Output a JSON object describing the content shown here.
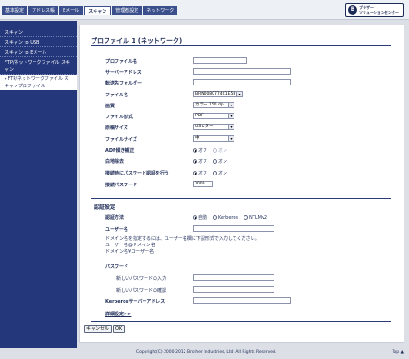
{
  "nav": {
    "tabs": [
      {
        "label": "基本設定",
        "active": false
      },
      {
        "label": "アドレス帳",
        "active": false
      },
      {
        "label": "Eメール",
        "active": false
      },
      {
        "label": "スキャン",
        "active": true
      },
      {
        "label": "管理者設定",
        "active": false
      },
      {
        "label": "ネットワーク",
        "active": false
      }
    ],
    "logo_mark": "B",
    "logo_line1": "ブラザー",
    "logo_line2": "ソリューションセンター"
  },
  "sidebar": {
    "items": [
      {
        "label": "スキャン",
        "active": false
      },
      {
        "label": "スキャン to USB",
        "active": false
      },
      {
        "label": "スキャン to Eメール",
        "active": false
      },
      {
        "label": "FTP/ネットワークファイル スキャン",
        "active": false
      },
      {
        "label": "FTP/ネットワークファイル スキャンプロファイル",
        "active": true,
        "marker": "▸"
      }
    ]
  },
  "main": {
    "title": "プロファイル 1 (ネットワーク)",
    "fields": {
      "profile_name": {
        "label": "プロファイル名",
        "value": ""
      },
      "server_address": {
        "label": "サーバーアドレス",
        "value": ""
      },
      "dest_folder": {
        "label": "転送先フォルダー",
        "value": ""
      },
      "file_name": {
        "label": "ファイル名",
        "value": "BRN0080774C1E58"
      },
      "quality": {
        "label": "画質",
        "value": "カラー 150 dpi"
      },
      "file_type": {
        "label": "ファイル形式",
        "value": "PDF"
      },
      "doc_size": {
        "label": "原稿サイズ",
        "value": "USレター"
      },
      "file_size": {
        "label": "ファイルサイズ",
        "value": "中"
      },
      "adf_deskew": {
        "label": "ADF傾き補正",
        "on": "オフ",
        "off": "オン"
      },
      "remove_bg": {
        "label": "白地除去",
        "on": "オフ",
        "off": "オン"
      },
      "pw_confirm": {
        "label": "接続時にパスワード認証を行う",
        "on": "オフ",
        "off": "オン"
      },
      "pin": {
        "label": "接続パスワード",
        "value": "0000"
      }
    },
    "auth": {
      "section_title": "認証設定",
      "method_label": "認証方法",
      "methods": [
        "自動",
        "Kerberos",
        "NTLMv2"
      ],
      "username_label": "ユーザー名",
      "username_value": "",
      "note_line1": "ドメイン名を指定するには、ユーザー名欄に下記形式で入力してください。",
      "note_line2": "ユーザー名@ドメイン名",
      "note_line3": "ドメイン名¥ユーザー名",
      "password_label": "パスワード",
      "new_password_label": "新しいパスワードの入力",
      "confirm_password_label": "新しいパスワードの確認",
      "kerberos_label": "Kerberosサーバーアドレス",
      "advanced_link": "詳細設定>>"
    },
    "buttons": {
      "cancel": "キャンセル",
      "ok": "OK"
    }
  },
  "footer": {
    "copyright": "Copyright(C) 2000-2012 Brother Industries, Ltd. All Rights Reserved.",
    "top_link": "Top ▲"
  }
}
